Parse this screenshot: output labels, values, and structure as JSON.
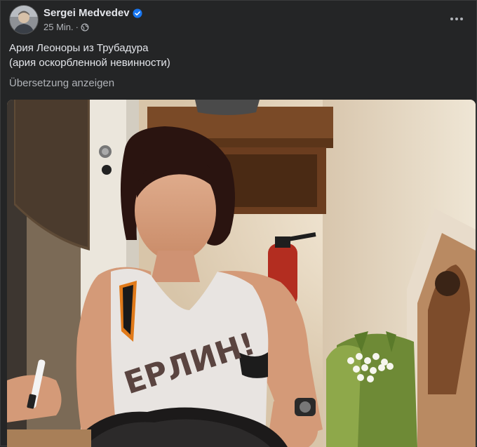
{
  "post": {
    "author": "Sergei Medvedev",
    "time": "25 Min.",
    "separator": "·",
    "text_line1": "Ария Леоноры из Трубадура",
    "text_line2": "(ария оскорбленной невинности)",
    "translate_label": "Übersetzung anzeigen"
  },
  "photo": {
    "shirt_text": "ЕРЛИН!"
  },
  "colors": {
    "background": "#242526",
    "primary_text": "#e4e6eb",
    "secondary_text": "#b0b3b8",
    "verified": "#1877f2"
  },
  "icons": {
    "verified": "verified-badge-icon",
    "audience": "globe-icon",
    "more": "more-options-icon"
  }
}
